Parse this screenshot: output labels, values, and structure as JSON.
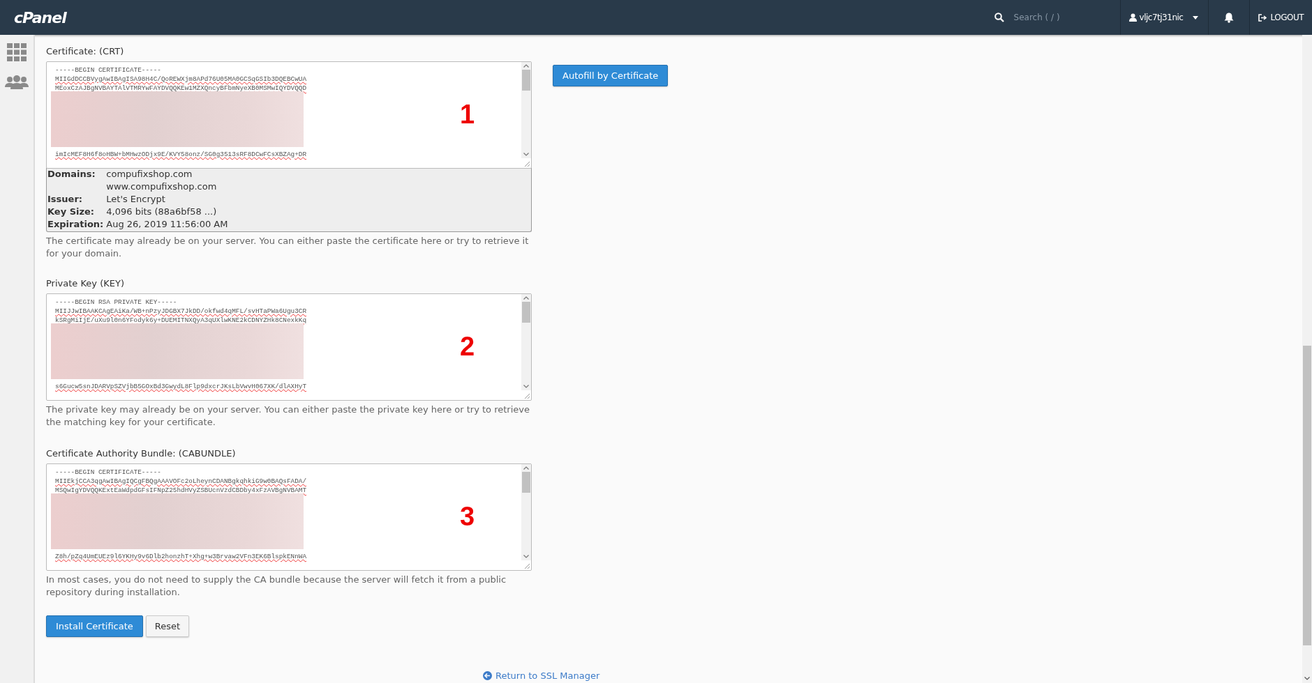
{
  "header": {
    "logo": "cPanel",
    "search": {
      "placeholder": "Search ( / )"
    },
    "user": "vljc7tj31nic",
    "logout": "LOGOUT"
  },
  "fields": [
    {
      "label": "Certificate: (CRT)",
      "lines_top": [
        "-----BEGIN CERTIFICATE-----",
        "MIIGdDCCBVygAwIBAgISA98H4C/QoREWXjm8APd76U05MA0GCSqGSIb3DQEBCwUA",
        "MEoxCzAJBgNVBAYTAlVTMRYwFAYDVQQKEw1MZXQncyBFbmNyeXB0MSMwIQYDVQQD"
      ],
      "lines_bottom": [
        "imIcMEF8H6f8oHBW+bMHwzODjx9E/KVY58onz/SG0g3513sRF8DCwFCsXBZAg+DR"
      ],
      "annotation": "1",
      "info": [
        {
          "label": "Domains:",
          "values": [
            "compufixshop.com",
            "www.compufixshop.com"
          ]
        },
        {
          "label": "Issuer:",
          "values": [
            "Let's Encrypt"
          ]
        },
        {
          "label": "Key Size:",
          "values": [
            "4,096 bits (88a6bf58 ...)"
          ]
        },
        {
          "label": "Expiration:",
          "values": [
            "Aug 26, 2019 11:56:00 AM"
          ]
        }
      ],
      "help": "The certificate may already be on your server. You can either paste the certificate here or try to retrieve it for your domain."
    },
    {
      "label": "Private Key (KEY)",
      "lines_top": [
        "-----BEGIN RSA PRIVATE KEY-----",
        "MIIJJwIBAAKCAgEAiKa/WB+nPzyJDGBX7JkDD/okfwd4qMFL/svHTaPWa6Ugu3CR",
        "kSRgMiIjE/uXu9l0n6YFodyk6y+DUEMITNXQyA3qUXlwKNE2kCDNYZHk8CNexkKq"
      ],
      "lines_bottom": [
        "s6Gucw5snJDARVpSZVjbB5GOxBd3GwydL8Flp9dxcrJKsLbVwvH067XK/dlAXHyT"
      ],
      "annotation": "2",
      "help": "The private key may already be on your server. You can either paste the private key here or try to retrieve the matching key for your certificate."
    },
    {
      "label": "Certificate Authority Bundle: (CABUNDLE)",
      "lines_top": [
        "-----BEGIN CERTIFICATE-----",
        "MIIEkjCCA3qgAwIBAgIQCgFBQgAAAVOFc2oLheynCDANBgkqhkiG9w0BAQsFADA/",
        "MSQwIgYDVQQKExtEaWdpdGFsIFNpZ25hdHVyZSBUcnVzdCBDby4xFzAVBgNVBAMT"
      ],
      "lines_bottom": [
        "Z8h/pZq4UmEUEz9l6YKHy9v6Dlb2honzhT+Xhg+w3Brvaw2VFn3EK6BlspkENnWA"
      ],
      "annotation": "3",
      "help": "In most cases, you do not need to supply the CA bundle because the server will fetch it from a public repository during installation."
    }
  ],
  "autofill_button": "Autofill by Certificate",
  "install_button": "Install Certificate",
  "reset_button": "Reset",
  "return_link": "Return to SSL Manager"
}
